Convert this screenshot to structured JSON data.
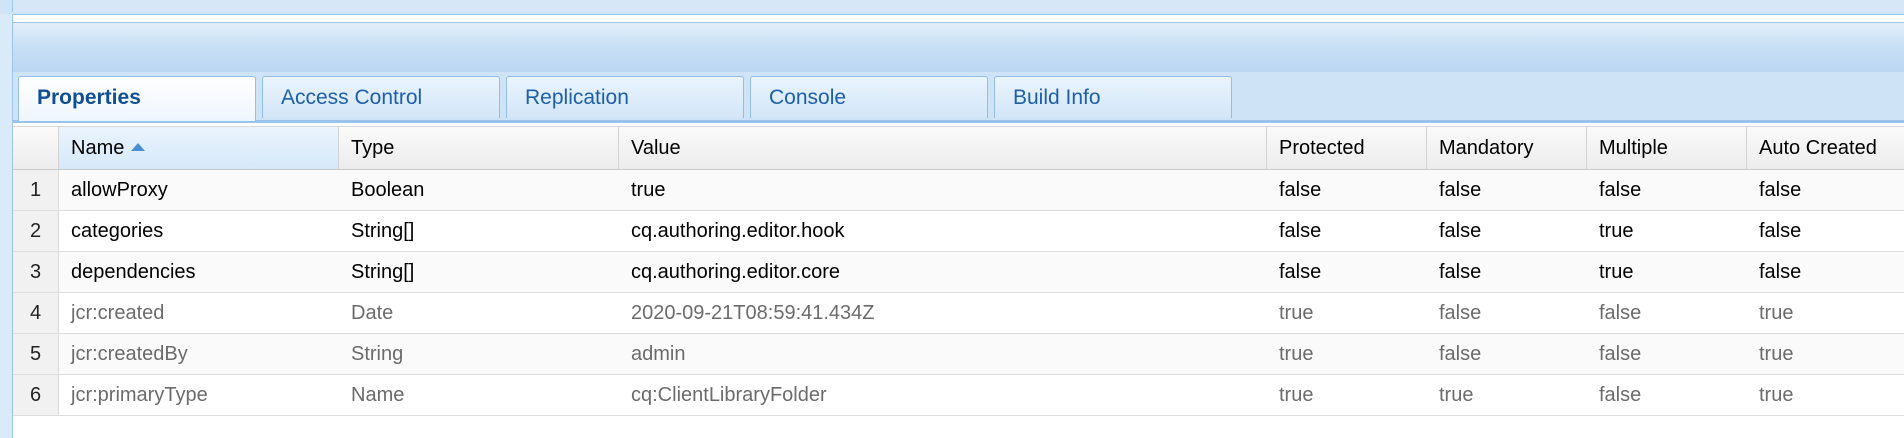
{
  "tabs": [
    {
      "label": "Properties",
      "active": true
    },
    {
      "label": "Access Control",
      "active": false
    },
    {
      "label": "Replication",
      "active": false
    },
    {
      "label": "Console",
      "active": false
    },
    {
      "label": "Build Info",
      "active": false
    }
  ],
  "columns": {
    "name": "Name",
    "type": "Type",
    "value": "Value",
    "protected": "Protected",
    "mandatory": "Mandatory",
    "multiple": "Multiple",
    "auto_created": "Auto Created"
  },
  "sort": {
    "column": "Name",
    "direction": "ascending"
  },
  "rows": [
    {
      "num": "1",
      "name": "allowProxy",
      "type": "Boolean",
      "value": "true",
      "protected": "false",
      "mandatory": "false",
      "multiple": "false",
      "auto_created": "false"
    },
    {
      "num": "2",
      "name": "categories",
      "type": "String[]",
      "value": "cq.authoring.editor.hook",
      "protected": "false",
      "mandatory": "false",
      "multiple": "true",
      "auto_created": "false"
    },
    {
      "num": "3",
      "name": "dependencies",
      "type": "String[]",
      "value": "cq.authoring.editor.core",
      "protected": "false",
      "mandatory": "false",
      "multiple": "true",
      "auto_created": "false"
    },
    {
      "num": "4",
      "name": "jcr:created",
      "type": "Date",
      "value": "2020-09-21T08:59:41.434Z",
      "protected": "true",
      "mandatory": "false",
      "multiple": "false",
      "auto_created": "true"
    },
    {
      "num": "5",
      "name": "jcr:createdBy",
      "type": "String",
      "value": "admin",
      "protected": "true",
      "mandatory": "false",
      "multiple": "false",
      "auto_created": "true"
    },
    {
      "num": "6",
      "name": "jcr:primaryType",
      "type": "Name",
      "value": "cq:ClientLibraryFolder",
      "protected": "true",
      "mandatory": "true",
      "multiple": "false",
      "auto_created": "true"
    }
  ]
}
